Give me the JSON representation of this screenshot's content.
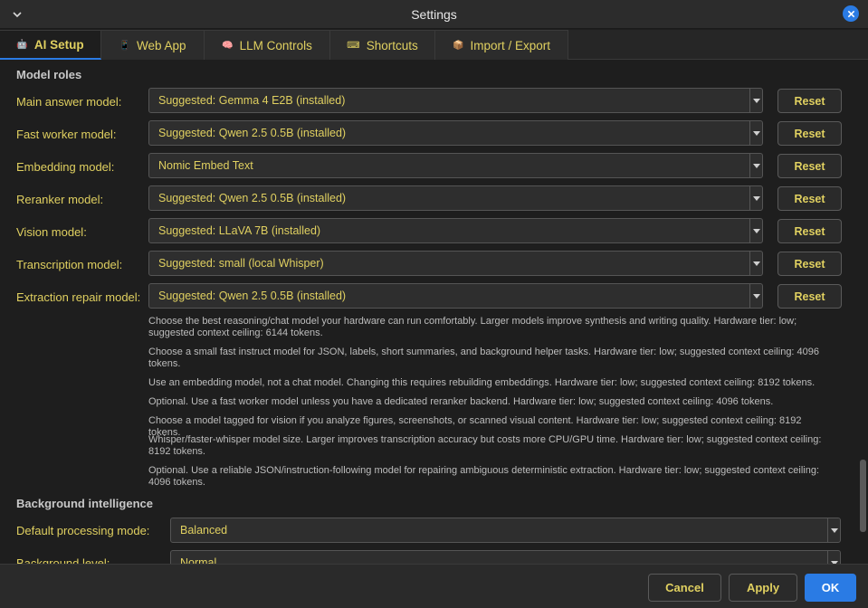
{
  "window": {
    "title": "Settings"
  },
  "tabs": [
    {
      "icon": "🤖",
      "label": "AI Setup"
    },
    {
      "icon": "📱",
      "label": "Web App"
    },
    {
      "icon": "🧠",
      "label": "LLM Controls"
    },
    {
      "icon": "⌨",
      "label": "Shortcuts"
    },
    {
      "icon": "📦",
      "label": "Import / Export"
    }
  ],
  "active_tab": "AI Setup",
  "model_roles": {
    "title": "Model roles",
    "rows": [
      {
        "label": "Main answer model:",
        "value": "Suggested: Gemma 4 E2B (installed)",
        "reset": "Reset"
      },
      {
        "label": "Fast worker model:",
        "value": "Suggested: Qwen 2.5 0.5B (installed)",
        "reset": "Reset"
      },
      {
        "label": "Embedding model:",
        "value": "Nomic Embed Text",
        "reset": "Reset"
      },
      {
        "label": "Reranker model:",
        "value": "Suggested: Qwen 2.5 0.5B (installed)",
        "reset": "Reset"
      },
      {
        "label": "Vision model:",
        "value": "Suggested: LLaVA 7B (installed)",
        "reset": "Reset"
      },
      {
        "label": "Transcription model:",
        "value": "Suggested: small (local Whisper)",
        "reset": "Reset"
      },
      {
        "label": "Extraction repair model:",
        "value": "Suggested: Qwen 2.5 0.5B (installed)",
        "reset": "Reset"
      }
    ],
    "hints": [
      "Choose the best reasoning/chat model your hardware can run comfortably. Larger models improve synthesis and writing quality. Hardware tier: low; suggested context ceiling: 6144 tokens.",
      "Choose a small fast instruct model for JSON, labels, short summaries, and background helper tasks. Hardware tier: low; suggested context ceiling: 4096 tokens.",
      "Use an embedding model, not a chat model. Changing this requires rebuilding embeddings. Hardware tier: low; suggested context ceiling: 8192 tokens.",
      "Optional. Use a fast worker model unless you have a dedicated reranker backend. Hardware tier: low; suggested context ceiling: 4096 tokens.",
      "Choose a model tagged for vision if you analyze figures, screenshots, or scanned visual content. Hardware tier: low; suggested context ceiling: 8192 tokens.",
      "Whisper/faster-whisper model size. Larger improves transcription accuracy but costs more CPU/GPU time. Hardware tier: low; suggested context ceiling: 8192 tokens.",
      "Optional. Use a reliable JSON/instruction-following model for repairing ambiguous deterministic extraction. Hardware tier: low; suggested context ceiling: 4096 tokens."
    ]
  },
  "background": {
    "title": "Background intelligence",
    "rows": [
      {
        "label": "Default processing mode:",
        "value": "Balanced"
      },
      {
        "label": "Background level:",
        "value": "Normal"
      }
    ]
  },
  "footer": {
    "cancel": "Cancel",
    "apply": "Apply",
    "ok": "OK"
  },
  "colors": {
    "accent": "#2a7be4",
    "label_text": "#e0d060",
    "background": "#1e1e1e"
  }
}
